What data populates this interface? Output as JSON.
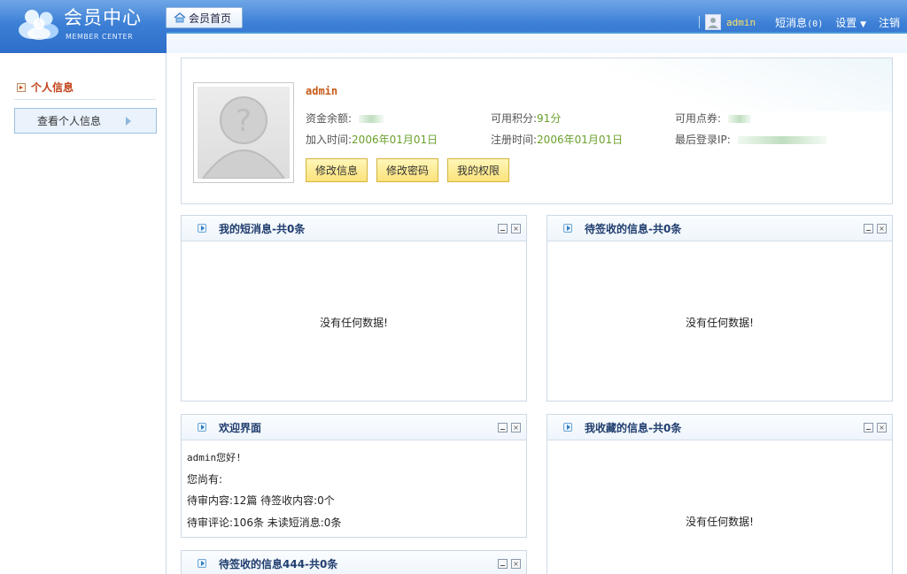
{
  "header": {
    "logo_title": "会员中心",
    "logo_sub": "MEMBER CENTER",
    "home_tab_label": "会员首页",
    "username": "admin",
    "messages_label": "短消息",
    "messages_count": "(0)",
    "settings_label": "设置",
    "logout_label": "注销",
    "corner_label": "HOME"
  },
  "sidebar": {
    "section_title": "个人信息",
    "items": [
      {
        "label": "查看个人信息"
      }
    ]
  },
  "profile": {
    "name": "admin",
    "balance_label": "资金余额:",
    "points_label": "可用积分:",
    "points_value": "91分",
    "coupons_label": "可用点券:",
    "join_label": "加入时间:",
    "join_value": "2006年01月01日",
    "register_label": "注册时间:",
    "register_value": "2006年01月01日",
    "last_ip_label": "最后登录IP:",
    "buttons": {
      "edit_info": "修改信息",
      "change_password": "修改密码",
      "my_permissions": "我的权限"
    }
  },
  "panels": {
    "messages": {
      "title": "我的短消息-共0条",
      "empty": "没有任何数据!"
    },
    "pending_sign": {
      "title": "待签收的信息-共0条",
      "empty": "没有任何数据!"
    },
    "welcome": {
      "title": "欢迎界面",
      "lines": [
        "admin您好!",
        "您尚有:",
        "待审内容:12篇 待签收内容:0个",
        "待审评论:106条 未读短消息:0条"
      ]
    },
    "favorites": {
      "title": "我收藏的信息-共0条",
      "empty": "没有任何数据!"
    },
    "pending_sign_444": {
      "title": "待签收的信息444-共0条"
    }
  },
  "colors": {
    "header_blue": "#3c7fd6",
    "accent_orange": "#c2431a",
    "value_green": "#6aa02c",
    "button_yellow": "#fbe27a",
    "panel_title": "#1f3d6e"
  }
}
